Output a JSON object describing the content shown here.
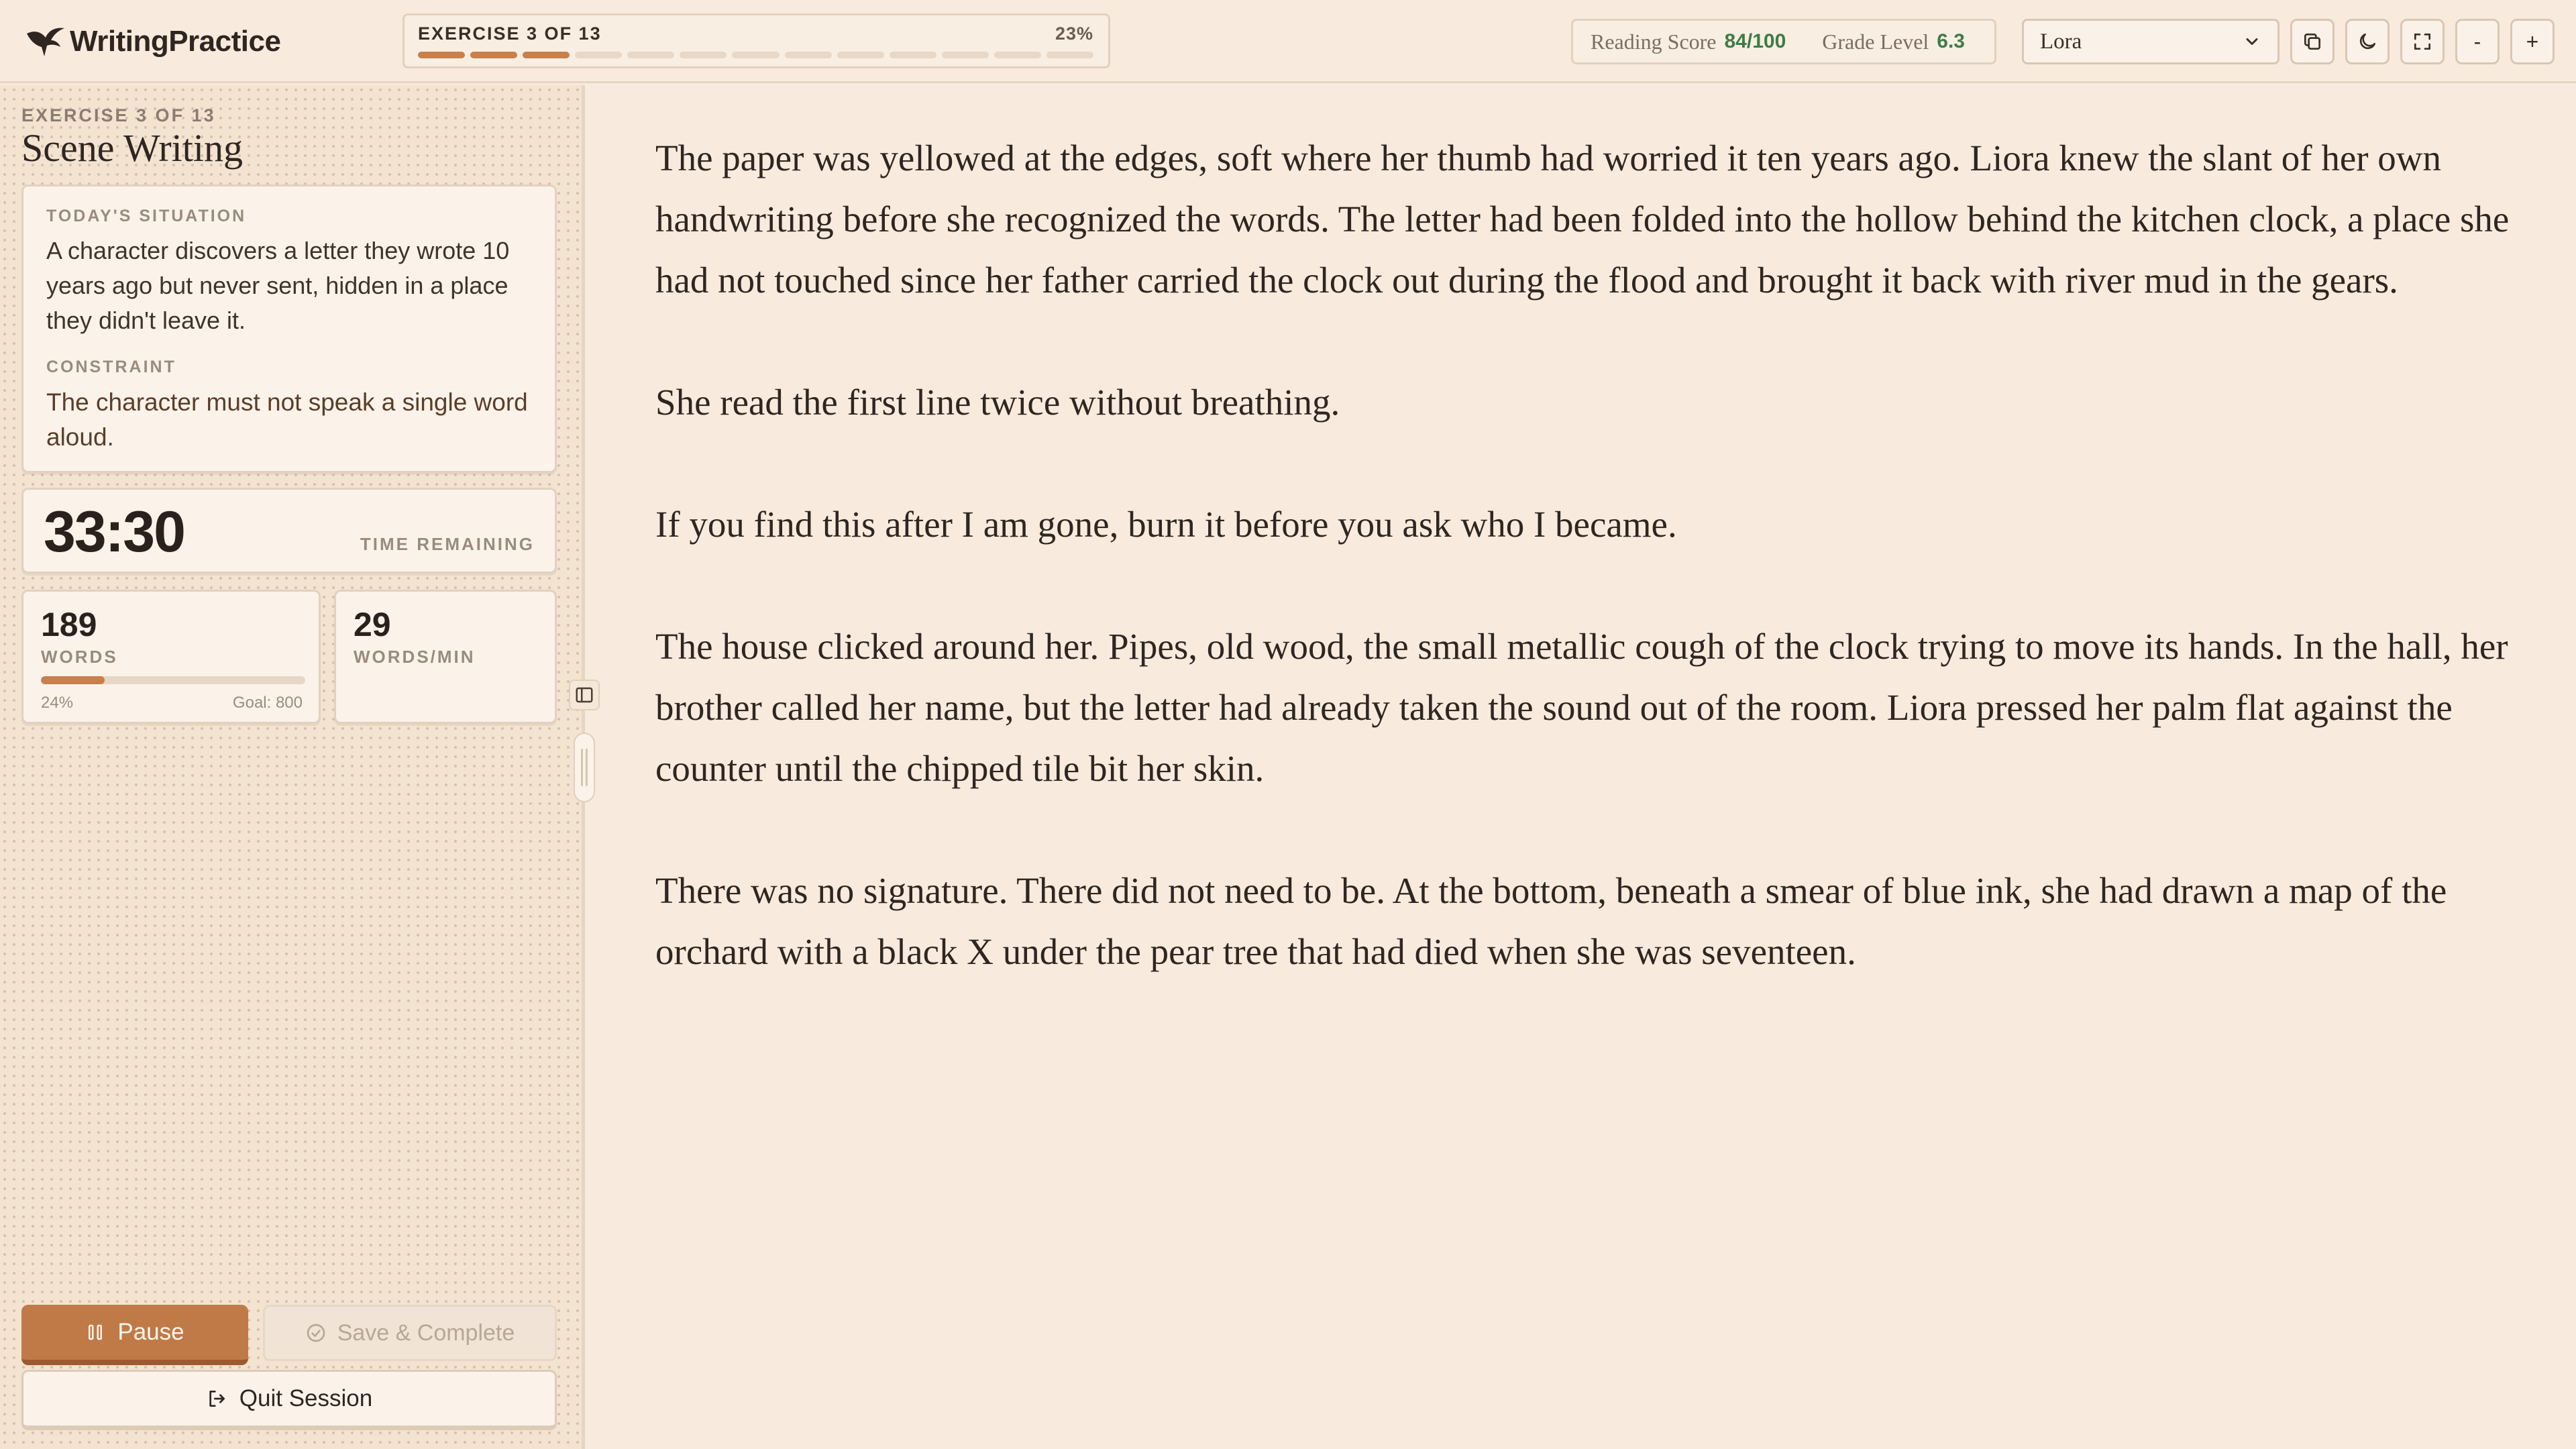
{
  "app": {
    "name": "WritingPractice"
  },
  "progress": {
    "label": "EXERCISE 3 OF 13",
    "percent_label": "23%",
    "current": 3,
    "total": 13
  },
  "scores": {
    "reading_label": "Reading Score",
    "reading_value": "84/100",
    "grade_label": "Grade Level",
    "grade_value": "6.3"
  },
  "font_select": {
    "value": "Lora"
  },
  "toolbar": {
    "zoom_out": "-",
    "zoom_in": "+"
  },
  "exercise": {
    "label": "EXERCISE 3 OF 13",
    "title": "Scene Writing",
    "situation_caption": "TODAY'S SITUATION",
    "situation": "A character discovers a letter they wrote 10 years ago but never sent, hidden in a place they didn't leave it.",
    "constraint_caption": "CONSTRAINT",
    "constraint": "The character must not speak a single word aloud."
  },
  "timer": {
    "value": "33:30",
    "label": "TIME REMAINING"
  },
  "stats": {
    "words_value": "189",
    "words_label": "WORDS",
    "words_progress": 0.24,
    "words_pct": "24%",
    "words_goal": "Goal: 800",
    "wpm_value": "29",
    "wpm_label": "WORDS/MIN"
  },
  "actions": {
    "pause": "Pause",
    "save": "Save & Complete",
    "quit": "Quit Session"
  },
  "editor": {
    "paragraphs": [
      "The paper was yellowed at the edges, soft where her thumb had worried it ten years ago. Liora knew the slant of her own handwriting before she recognized the words. The letter had been folded into the hollow behind the kitchen clock, a place she had not touched since her father carried the clock out during the flood and brought it back with river mud in the gears.",
      "She read the first line twice without breathing.",
      "If you find this after I am gone, burn it before you ask who I became.",
      "The house clicked around her. Pipes, old wood, the small metallic cough of the clock trying to move its hands. In the hall, her brother called her name, but the letter had already taken the sound out of the room. Liora pressed her palm flat against the counter until the chipped tile bit her skin.",
      "There was no signature. There did not need to be. At the bottom, beneath a smear of blue ink, she had drawn a map of the orchard with a black X under the pear tree that had died when she was seventeen."
    ]
  },
  "colors": {
    "accent": "#c8804d",
    "score_green": "#3e7c48",
    "background": "#f8ebdd"
  }
}
